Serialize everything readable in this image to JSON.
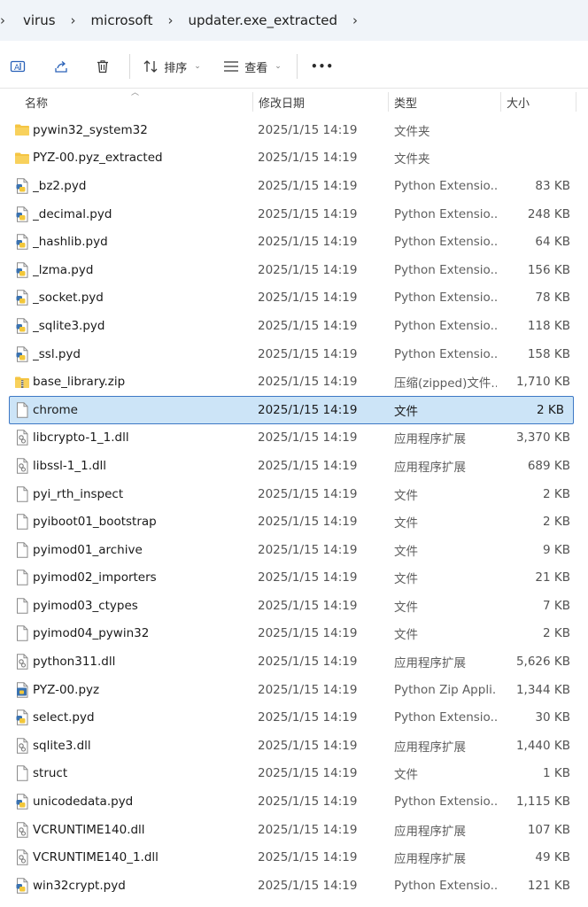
{
  "breadcrumb": [
    "virus",
    "microsoft",
    "updater.exe_extracted"
  ],
  "toolbar": {
    "sort_label": "排序",
    "view_label": "查看",
    "more_label": "•••"
  },
  "columns": {
    "name": "名称",
    "date": "修改日期",
    "type": "类型",
    "size": "大小"
  },
  "files": [
    {
      "name": "pywin32_system32",
      "date": "2025/1/15 14:19",
      "type": "文件夹",
      "size": "",
      "icon": "folder-icon"
    },
    {
      "name": "PYZ-00.pyz_extracted",
      "date": "2025/1/15 14:19",
      "type": "文件夹",
      "size": "",
      "icon": "folder-icon"
    },
    {
      "name": "_bz2.pyd",
      "date": "2025/1/15 14:19",
      "type": "Python Extensio...",
      "size": "83 KB",
      "icon": "python-file-icon"
    },
    {
      "name": "_decimal.pyd",
      "date": "2025/1/15 14:19",
      "type": "Python Extensio...",
      "size": "248 KB",
      "icon": "python-file-icon"
    },
    {
      "name": "_hashlib.pyd",
      "date": "2025/1/15 14:19",
      "type": "Python Extensio...",
      "size": "64 KB",
      "icon": "python-file-icon"
    },
    {
      "name": "_lzma.pyd",
      "date": "2025/1/15 14:19",
      "type": "Python Extensio...",
      "size": "156 KB",
      "icon": "python-file-icon"
    },
    {
      "name": "_socket.pyd",
      "date": "2025/1/15 14:19",
      "type": "Python Extensio...",
      "size": "78 KB",
      "icon": "python-file-icon"
    },
    {
      "name": "_sqlite3.pyd",
      "date": "2025/1/15 14:19",
      "type": "Python Extensio...",
      "size": "118 KB",
      "icon": "python-file-icon"
    },
    {
      "name": "_ssl.pyd",
      "date": "2025/1/15 14:19",
      "type": "Python Extensio...",
      "size": "158 KB",
      "icon": "python-file-icon"
    },
    {
      "name": "base_library.zip",
      "date": "2025/1/15 14:19",
      "type": "压缩(zipped)文件...",
      "size": "1,710 KB",
      "icon": "zip-folder-icon"
    },
    {
      "name": "chrome",
      "date": "2025/1/15 14:19",
      "type": "文件",
      "size": "2 KB",
      "icon": "blank-file-icon",
      "selected": true
    },
    {
      "name": "libcrypto-1_1.dll",
      "date": "2025/1/15 14:19",
      "type": "应用程序扩展",
      "size": "3,370 KB",
      "icon": "dll-file-icon"
    },
    {
      "name": "libssl-1_1.dll",
      "date": "2025/1/15 14:19",
      "type": "应用程序扩展",
      "size": "689 KB",
      "icon": "dll-file-icon"
    },
    {
      "name": "pyi_rth_inspect",
      "date": "2025/1/15 14:19",
      "type": "文件",
      "size": "2 KB",
      "icon": "blank-file-icon"
    },
    {
      "name": "pyiboot01_bootstrap",
      "date": "2025/1/15 14:19",
      "type": "文件",
      "size": "2 KB",
      "icon": "blank-file-icon"
    },
    {
      "name": "pyimod01_archive",
      "date": "2025/1/15 14:19",
      "type": "文件",
      "size": "9 KB",
      "icon": "blank-file-icon"
    },
    {
      "name": "pyimod02_importers",
      "date": "2025/1/15 14:19",
      "type": "文件",
      "size": "21 KB",
      "icon": "blank-file-icon"
    },
    {
      "name": "pyimod03_ctypes",
      "date": "2025/1/15 14:19",
      "type": "文件",
      "size": "7 KB",
      "icon": "blank-file-icon"
    },
    {
      "name": "pyimod04_pywin32",
      "date": "2025/1/15 14:19",
      "type": "文件",
      "size": "2 KB",
      "icon": "blank-file-icon"
    },
    {
      "name": "python311.dll",
      "date": "2025/1/15 14:19",
      "type": "应用程序扩展",
      "size": "5,626 KB",
      "icon": "dll-file-icon"
    },
    {
      "name": "PYZ-00.pyz",
      "date": "2025/1/15 14:19",
      "type": "Python Zip Appli...",
      "size": "1,344 KB",
      "icon": "python-zip-icon"
    },
    {
      "name": "select.pyd",
      "date": "2025/1/15 14:19",
      "type": "Python Extensio...",
      "size": "30 KB",
      "icon": "python-file-icon"
    },
    {
      "name": "sqlite3.dll",
      "date": "2025/1/15 14:19",
      "type": "应用程序扩展",
      "size": "1,440 KB",
      "icon": "dll-file-icon"
    },
    {
      "name": "struct",
      "date": "2025/1/15 14:19",
      "type": "文件",
      "size": "1 KB",
      "icon": "blank-file-icon"
    },
    {
      "name": "unicodedata.pyd",
      "date": "2025/1/15 14:19",
      "type": "Python Extensio...",
      "size": "1,115 KB",
      "icon": "python-file-icon"
    },
    {
      "name": "VCRUNTIME140.dll",
      "date": "2025/1/15 14:19",
      "type": "应用程序扩展",
      "size": "107 KB",
      "icon": "dll-file-icon"
    },
    {
      "name": "VCRUNTIME140_1.dll",
      "date": "2025/1/15 14:19",
      "type": "应用程序扩展",
      "size": "49 KB",
      "icon": "dll-file-icon"
    },
    {
      "name": "win32crypt.pyd",
      "date": "2025/1/15 14:19",
      "type": "Python Extensio...",
      "size": "121 KB",
      "icon": "python-file-icon"
    }
  ],
  "colors": {
    "selection_bg": "#cce4f7",
    "selection_border": "#3d78c5",
    "folder": "#f3c440",
    "breadcrumb_bg": "#f0f4f9"
  }
}
